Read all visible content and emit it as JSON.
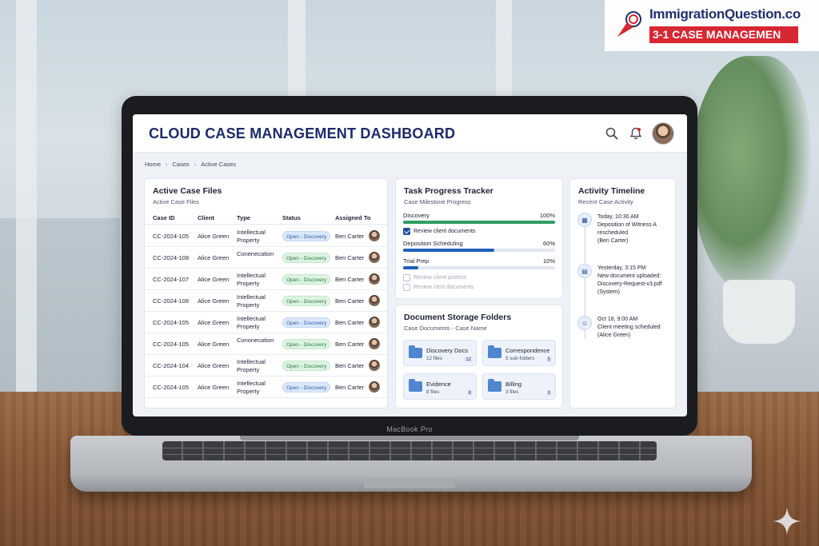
{
  "overlay": {
    "site": "ImmigrationQuestion.co",
    "subtitle": "3-1 CASE MANAGEMEN"
  },
  "laptop": {
    "model_label": "MacBook Pro"
  },
  "dashboard": {
    "title": "CLOUD CASE MANAGEMENT DASHBOARD",
    "icons": [
      "search-icon",
      "bell-icon",
      "user-avatar"
    ],
    "breadcrumb": [
      "Home",
      "Cases",
      "Active Cases"
    ],
    "cases": {
      "title": "Active Case Files",
      "subtitle": "Active Case Files",
      "columns": [
        "Case ID",
        "Client",
        "Type",
        "Status",
        "Assigned To"
      ],
      "rows": [
        {
          "id": "CC-2024-105",
          "client": "Alice Green",
          "type": "Intellectual Property",
          "status": "Open - Discovery",
          "status_color": "blue",
          "assigned": "Ben Carter"
        },
        {
          "id": "CC-2024-108",
          "client": "Alice Green",
          "type": "Conenecation",
          "status": "Open - Discovery",
          "status_color": "green",
          "assigned": "Ben Carter"
        },
        {
          "id": "CC-2024-107",
          "client": "Alice Green",
          "type": "Intellectual Property",
          "status": "Open - Discovery",
          "status_color": "green",
          "assigned": "Ben Carter"
        },
        {
          "id": "CC-2024-108",
          "client": "Alice Green",
          "type": "Intellectual Property",
          "status": "Open - Discovery",
          "status_color": "green",
          "assigned": "Ben Carter"
        },
        {
          "id": "CC-2024-105",
          "client": "Alice Green",
          "type": "Intellectual Property",
          "status": "Open - Discovery",
          "status_color": "blue",
          "assigned": "Ben Carter"
        },
        {
          "id": "CC-2024-105",
          "client": "Alice Green",
          "type": "Cononecation",
          "status": "Open - Discovery",
          "status_color": "green",
          "assigned": "Ben Carter"
        },
        {
          "id": "CC-2024-104",
          "client": "Alice Green",
          "type": "Intellectual Property",
          "status": "Open - Discovery",
          "status_color": "green",
          "assigned": "Ben Carter"
        },
        {
          "id": "CC-2024-105",
          "client": "Alice Green",
          "type": "Intellectual Property",
          "status": "Open - Discovery",
          "status_color": "blue",
          "assigned": "Ben Carter"
        }
      ]
    },
    "tracker": {
      "title": "Task Progress Tracker",
      "subtitle": "Case Milestone Progress",
      "milestones": [
        {
          "label": "Discovery",
          "percent_label": "100%",
          "progress": 1.0,
          "color": "#2e9e62"
        },
        {
          "label": "Deposition Scheduling",
          "percent_label": "60%",
          "progress": 0.6,
          "color": "#1f5fbf"
        },
        {
          "label": "Trial Prep",
          "percent_label": "10%",
          "progress": 0.1,
          "color": "#1f5fbf"
        }
      ],
      "tasks": [
        {
          "label": "Review client documents",
          "checked": true
        },
        {
          "label": "Review client protess",
          "checked": false
        },
        {
          "label": "Review clest documents",
          "checked": false
        }
      ]
    },
    "folders": {
      "title": "Document Storage Folders",
      "subtitle": "Case Documents - Case Name",
      "items": [
        {
          "name": "Discovery Docs",
          "count": "12 files",
          "badge": "12"
        },
        {
          "name": "Correspondence",
          "count": "5 sub-folders",
          "badge": "5"
        },
        {
          "name": "Evidence",
          "count": "8 files",
          "badge": "8"
        },
        {
          "name": "Billing",
          "count": "3 files",
          "badge": "3"
        }
      ]
    },
    "timeline": {
      "title": "Activity Timeline",
      "subtitle": "Recent Case Activity",
      "events": [
        {
          "icon": "calendar-icon",
          "lines": [
            "Today, 10:30 AM",
            "Deposition of Witness A",
            "rescheduled",
            "(Ben Carter)"
          ]
        },
        {
          "icon": "document-icon",
          "lines": [
            "Yesterday, 3:15 PM",
            "New document uploaded:",
            "Discovery-Request-v3.pdf",
            "(System)"
          ]
        },
        {
          "icon": "user-icon",
          "lines": [
            "Oct 18, 9:00 AM",
            "Client meeting scheduled",
            "(Alice Green)"
          ]
        }
      ]
    }
  },
  "colors": {
    "title_navy": "#1d2a6b",
    "accent_red": "#d8222d",
    "status_green": "#2f7a43",
    "status_blue": "#2c5ba8"
  }
}
